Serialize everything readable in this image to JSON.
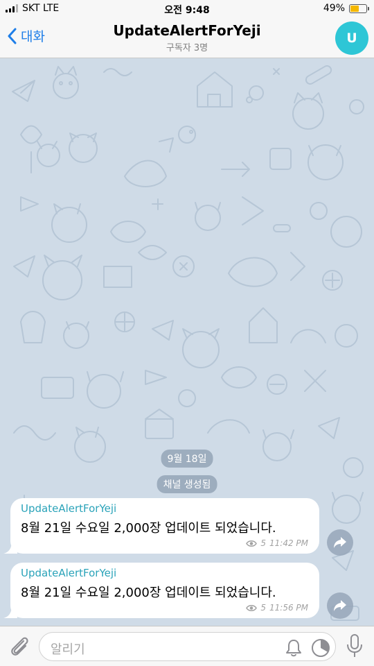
{
  "status_bar": {
    "carrier": "SKT LTE",
    "time": "오전 9:48",
    "battery": "49%",
    "battery_level": 0.49
  },
  "nav": {
    "back_label": "대화",
    "title": "UpdateAlertForYeji",
    "subtitle": "구독자 3명",
    "avatar_letter": "U"
  },
  "chat": {
    "date_label": "9월 18일",
    "service_message": "채널 생성됨",
    "messages": [
      {
        "sender": "UpdateAlertForYeji",
        "text": "8월 21일 수요일 2,000장 업데이트 되었습니다.",
        "views": "5",
        "time": "11:42 PM"
      },
      {
        "sender": "UpdateAlertForYeji",
        "text": "8월 21일 수요일 2,000장 업데이트 되었습니다.",
        "views": "5",
        "time": "11:56 PM"
      }
    ]
  },
  "input": {
    "placeholder": "알리기"
  },
  "colors": {
    "accent": "#1e7ee8",
    "avatar": "#2ec6d6",
    "sender": "#2aa3b9",
    "chat_bg": "#cfdbe7",
    "battery": "#f5b800"
  },
  "icons": [
    "chevron-left-icon",
    "eye-icon",
    "share-arrow-icon",
    "paperclip-icon",
    "bell-icon",
    "clock-icon",
    "microphone-icon"
  ]
}
